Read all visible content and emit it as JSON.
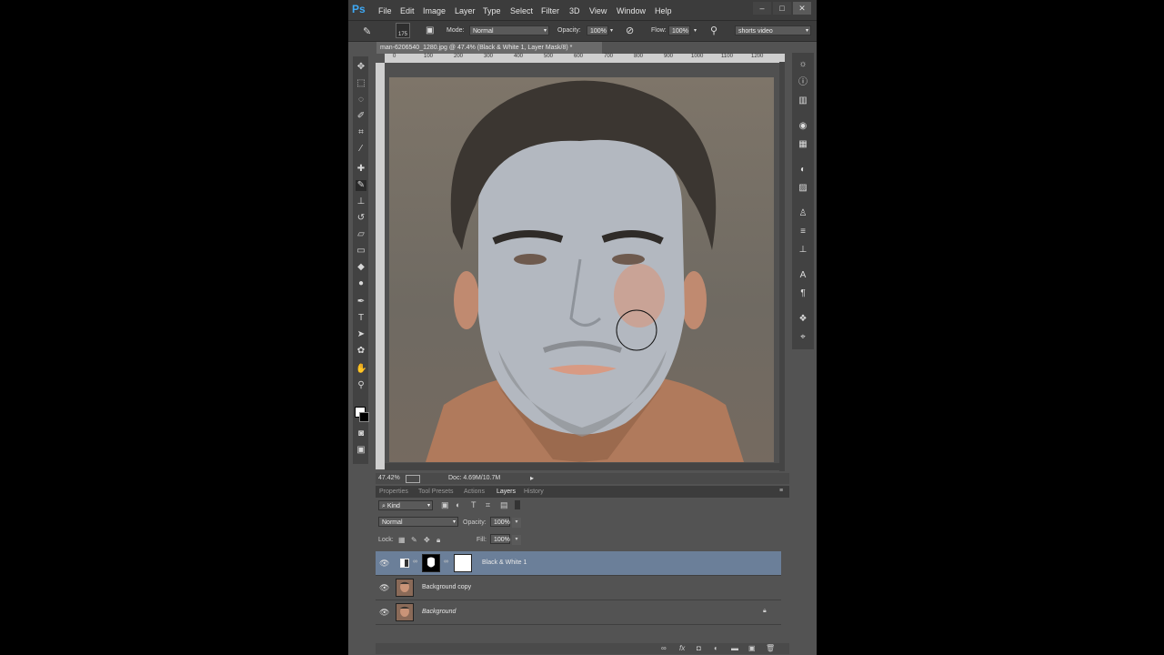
{
  "app": {
    "logo": "Ps"
  },
  "menu": [
    "File",
    "Edit",
    "Image",
    "Layer",
    "Type",
    "Select",
    "Filter",
    "3D",
    "View",
    "Window",
    "Help"
  ],
  "window_buttons": [
    "–",
    "□",
    "✕"
  ],
  "options": {
    "brush_size": "175",
    "mode_label": "Mode:",
    "mode_value": "Normal",
    "opacity_label": "Opacity:",
    "opacity_value": "100%",
    "flow_label": "Flow:",
    "flow_value": "100%",
    "workspace_value": "shorts video"
  },
  "document_tab": "man-6206540_1280.jpg @ 47.4% (Black & White 1, Layer Mask/8) *",
  "ruler_labels": [
    "0",
    "100",
    "200",
    "300",
    "400",
    "500",
    "600",
    "700",
    "800",
    "900",
    "1000",
    "1100",
    "1200"
  ],
  "status": {
    "zoom": "47.42%",
    "doc": "Doc: 4.69M/10.7M"
  },
  "panel_tabs": [
    "Properties",
    "Tool Presets",
    "Actions",
    "Layers",
    "History"
  ],
  "active_panel_tab": "Layers",
  "layers_panel": {
    "filter_kind": "Kind",
    "blend_mode": "Normal",
    "opacity_label": "Opacity:",
    "opacity_value": "100%",
    "lock_label": "Lock:",
    "fill_label": "Fill:",
    "fill_value": "100%",
    "layers": [
      {
        "name": "Black & White 1",
        "selected": true
      },
      {
        "name": "Background copy",
        "selected": false
      },
      {
        "name": "Background",
        "selected": false,
        "locked": true
      }
    ]
  },
  "colors": {
    "selected_layer": "#6b7f99",
    "panel_bg": "#535353",
    "menu_bg": "#3c3c3c",
    "logo_blue": "#3ea8f4"
  }
}
